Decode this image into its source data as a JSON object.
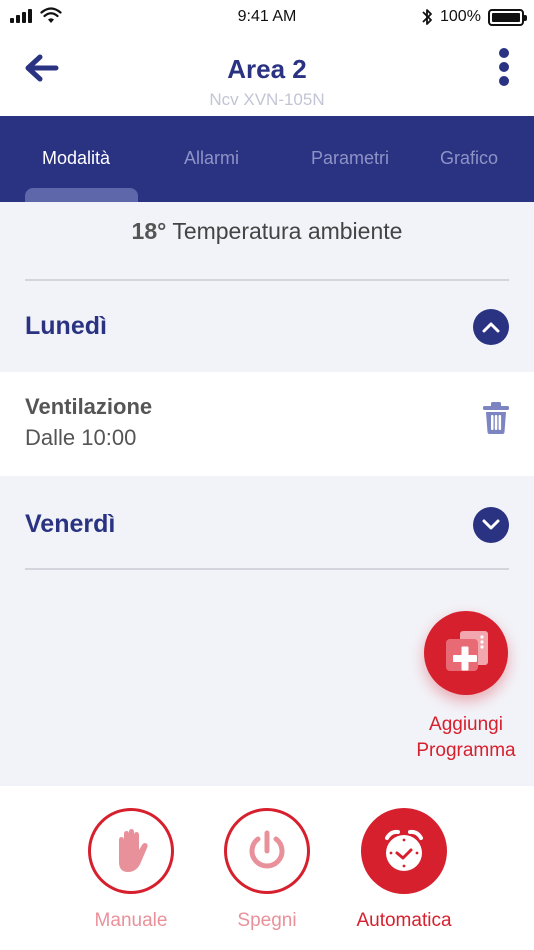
{
  "status_bar": {
    "time": "9:41 AM",
    "battery": "100%"
  },
  "header": {
    "title": "Area 2",
    "subtitle": "Ncv XVN-105N"
  },
  "tabs": [
    {
      "label": "Modalità",
      "active": true
    },
    {
      "label": "Allarmi",
      "active": false
    },
    {
      "label": "Parametri",
      "active": false
    },
    {
      "label": "Grafico",
      "active": false
    }
  ],
  "ambient": {
    "temperature": "18°",
    "label": "Temperatura ambiente"
  },
  "days": [
    {
      "name": "Lunedì",
      "expanded": true,
      "programs": [
        {
          "name": "Ventilazione",
          "time": "Dalle 10:00"
        }
      ]
    },
    {
      "name": "Venerdì",
      "expanded": false,
      "programs": []
    }
  ],
  "fab": {
    "label_line1": "Aggiungi",
    "label_line2": "Programma"
  },
  "modes": [
    {
      "label": "Manuale",
      "icon": "hand-icon",
      "active": false
    },
    {
      "label": "Spegni",
      "icon": "power-icon",
      "active": false
    },
    {
      "label": "Automatica",
      "icon": "clock-icon",
      "active": true
    }
  ],
  "colors": {
    "primary": "#2a3282",
    "accent": "#d6202e",
    "accent_light": "#e9919a",
    "background": "#f2f3f8"
  }
}
